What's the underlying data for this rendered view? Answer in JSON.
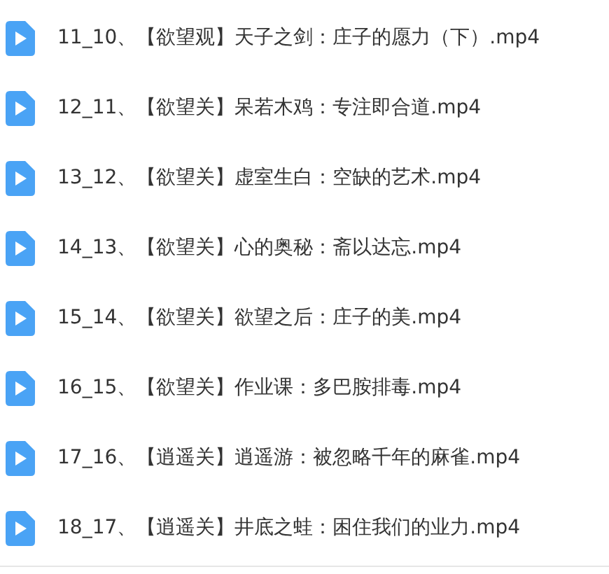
{
  "files": [
    {
      "name": "11_10、【欲望观】天子之剑：庄子的愿力（下）.mp4"
    },
    {
      "name": "12_11、【欲望关】呆若木鸡：专注即合道.mp4"
    },
    {
      "name": "13_12、【欲望关】虚室生白：空缺的艺术.mp4"
    },
    {
      "name": "14_13、【欲望关】心的奥秘：斋以达忘.mp4"
    },
    {
      "name": "15_14、【欲望关】欲望之后：庄子的美.mp4"
    },
    {
      "name": "16_15、【欲望关】作业课：多巴胺排毒.mp4"
    },
    {
      "name": "17_16、【逍遥关】逍遥游：被忽略千年的麻雀.mp4"
    },
    {
      "name": "18_17、【逍遥关】井底之蛙：困住我们的业力.mp4"
    }
  ]
}
